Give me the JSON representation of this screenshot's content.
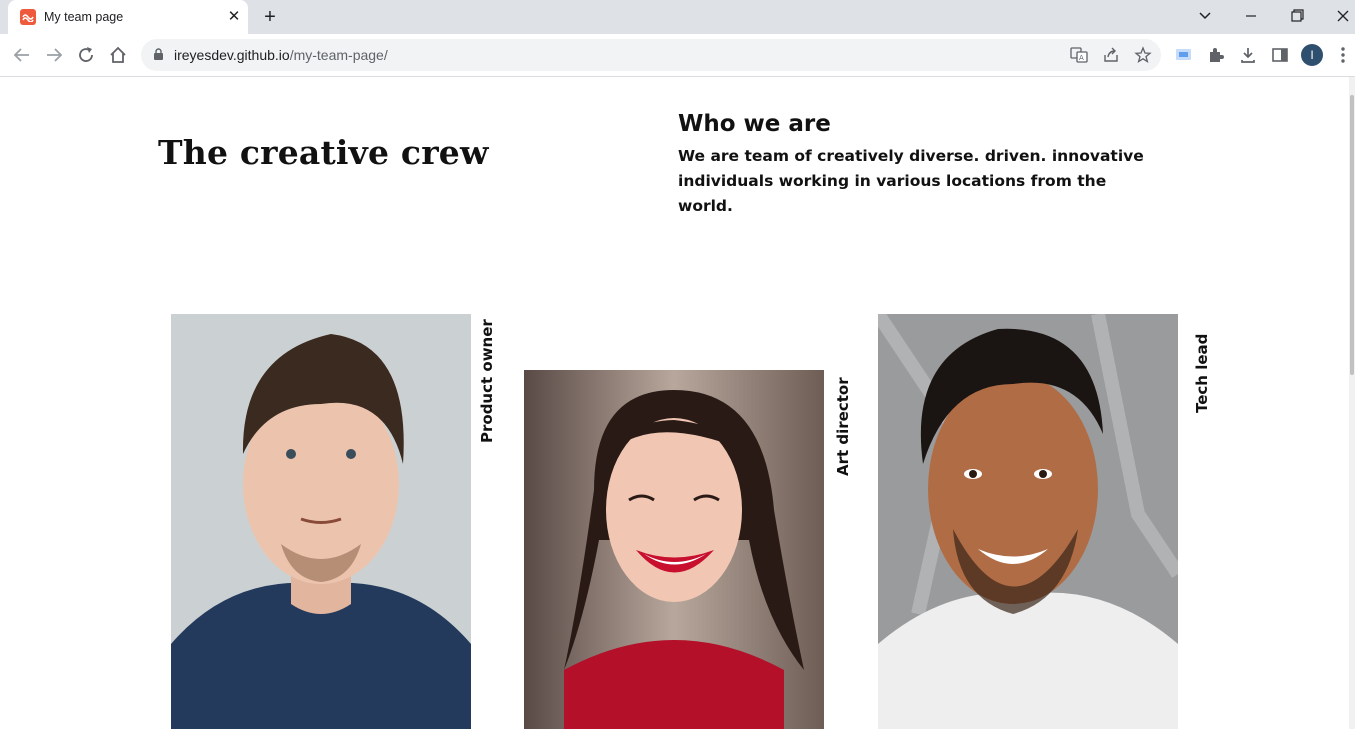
{
  "browser": {
    "tab_title": "My team page",
    "tab_close": "✕",
    "new_tab": "+",
    "url_domain": "ireyesdev.github.io",
    "url_path": "/my-team-page/",
    "profile_initial": "I"
  },
  "page": {
    "heading": "The creative crew",
    "about_title": "Who we are",
    "about_text": "We are team of creatively diverse. driven. innovative individuals working in various locations from the world."
  },
  "team": [
    {
      "role": "Product owner",
      "icon": "portrait-man-navy-polo"
    },
    {
      "role": "Art director",
      "icon": "portrait-woman-red-top"
    },
    {
      "role": "Tech lead",
      "icon": "portrait-man-white-tee"
    }
  ],
  "colors": {
    "tabstrip": "#dee1e6",
    "favicon": "#ef5a3c",
    "text": "#111111"
  }
}
